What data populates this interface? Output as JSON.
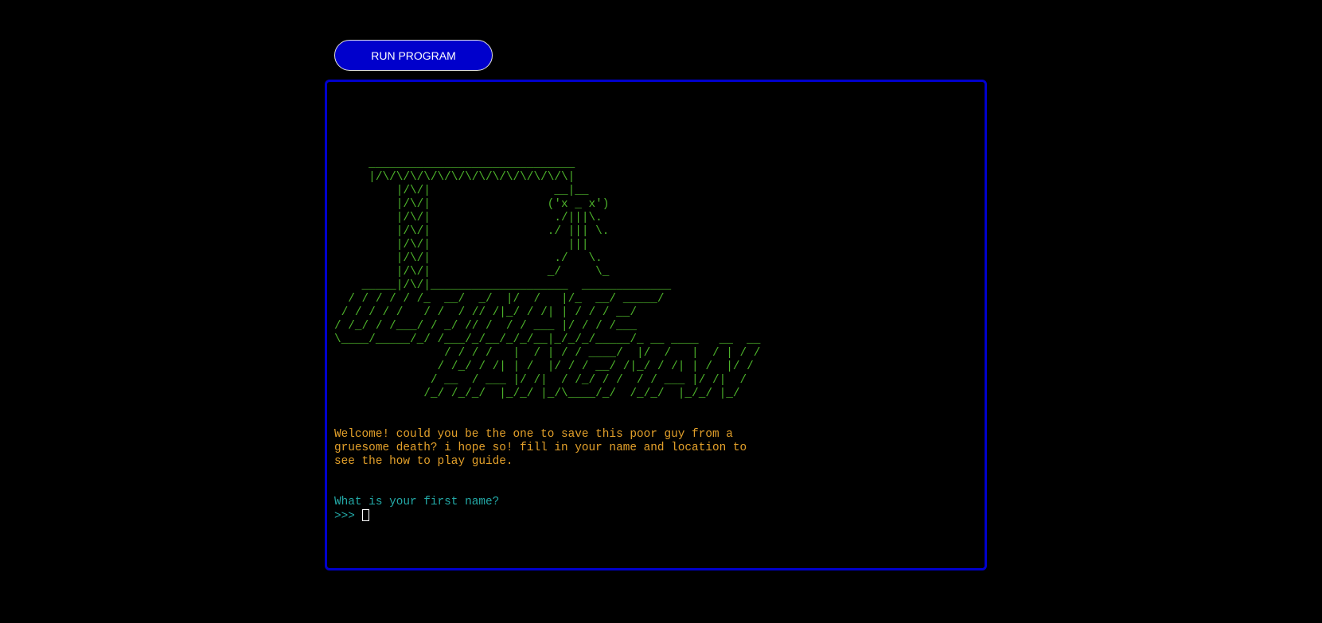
{
  "toolbar": {
    "run_label": "RUN PROGRAM"
  },
  "terminal": {
    "ascii_art": "     ______________________________\n     |/\\/\\/\\/\\/\\/\\/\\/\\/\\/\\/\\/\\/\\/\\|\n         |/\\/|                  __|__\n         |/\\/|                 ('x _ x')\n         |/\\/|                  ./|||\\.\n         |/\\/|                 ./ ||| \\.\n         |/\\/|                    |||\n         |/\\/|                  ./   \\.\n         |/\\/|                 _/     \\_\n    _____|/\\/|____________________  _____________\n  / / / / / /_  __/  _/  |/  /   |/_  __/ _____/\n / / / / /   / /  / // /|_/ / /| | / / / __/\n/ /_/ / /___/ / _/ // /  / / ___ |/ / / /___\n\\____/_____/_/ /___/_/__/_/_/__|_/_/_/_____/_ __ ____   __  __\n                / / / /   |  / | / / ____/  |/  /   |  / | / /\n               / /_/ / /| | /  |/ / / __/ /|_/ / /| | /  |/ /\n              / __  / ___ |/ /|  / /_/ / /  / / ___ |/ /|  /\n             /_/ /_/_/  |_/_/ |_/\\____/_/  /_/_/  |_/_/ |_/",
    "welcome": "Welcome! could you be the one to save this poor guy from a\ngruesome death? i hope so! fill in your name and location to\nsee the how to play guide.",
    "question": "What is your first name?",
    "prompt": ">>> "
  },
  "colors": {
    "background": "#000000",
    "terminal_border": "#0000cc",
    "button_bg": "#0000cc",
    "ascii_green": "#4db32b",
    "welcome_orange": "#e3a02a",
    "prompt_teal": "#23a9a7"
  }
}
